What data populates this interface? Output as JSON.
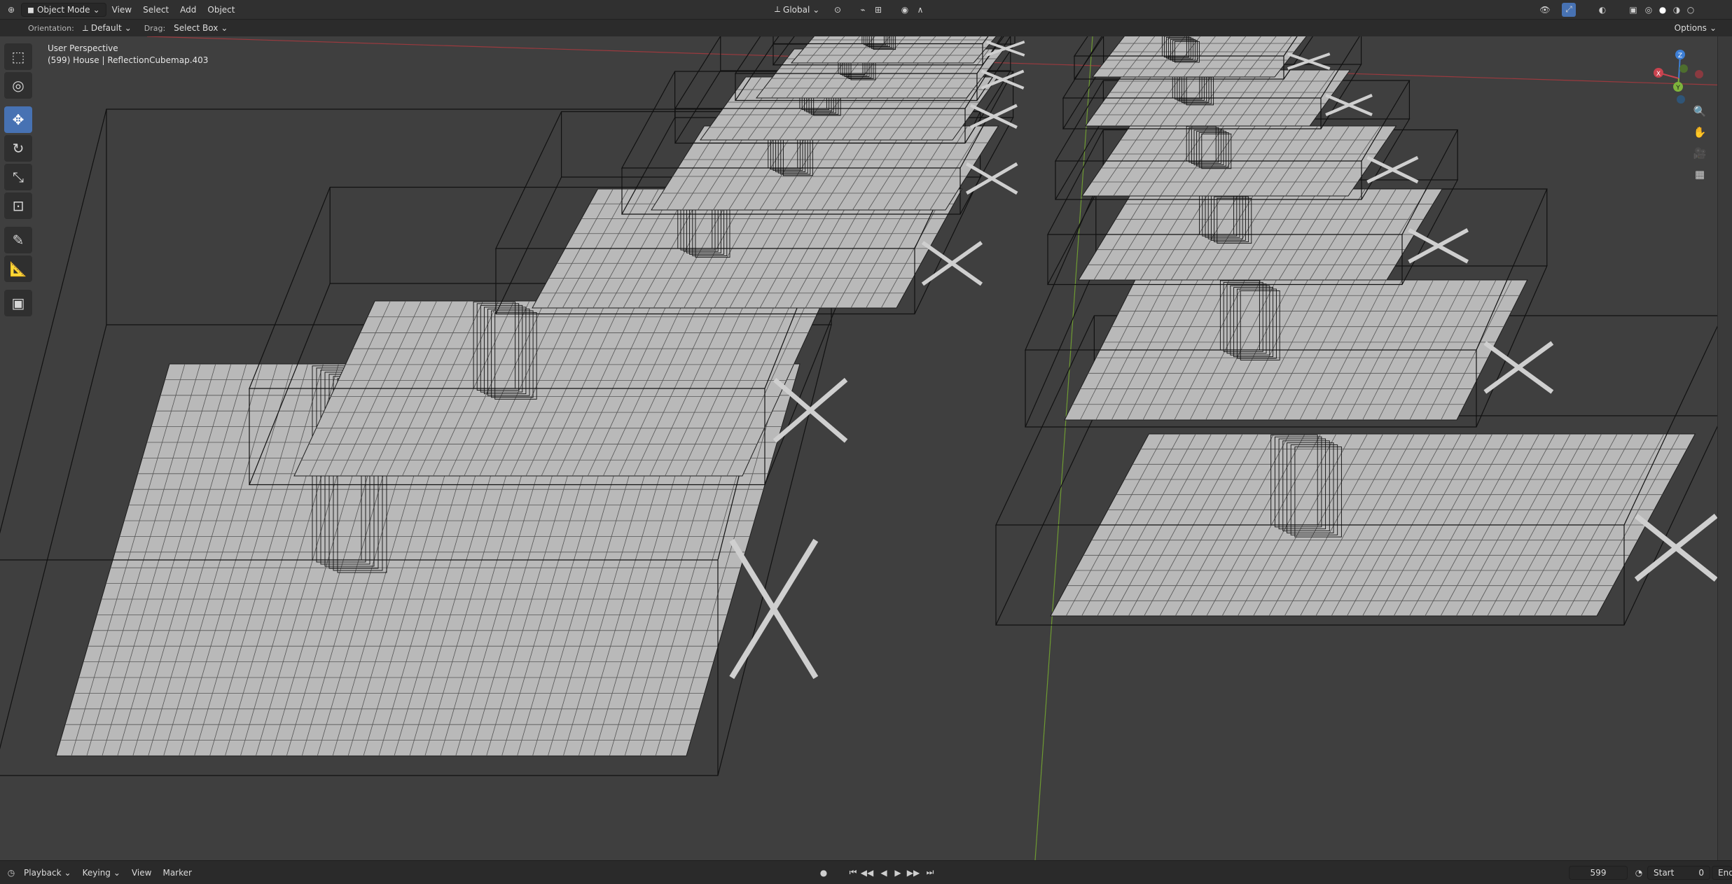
{
  "header": {
    "mode": "Object Mode",
    "menus": [
      "View",
      "Select",
      "Add",
      "Object"
    ],
    "transform_orientation": "Global",
    "options": "Options"
  },
  "tool_settings": {
    "orientation_label": "Orientation:",
    "orientation_value": "Default",
    "drag_label": "Drag:",
    "drag_value": "Select Box"
  },
  "viewport": {
    "perspective": "User Perspective",
    "active_object": "(599) House | ReflectionCubemap.403",
    "gizmo_axes": {
      "z": "Z",
      "y": "Y",
      "x": "X"
    },
    "colors": {
      "x_axis": "#c9434f",
      "y_axis": "#7fb33c",
      "z_axis": "#3d7fd6",
      "active_tool": "#4772b3"
    }
  },
  "toolbar": {
    "tools": [
      "select-box",
      "cursor",
      "move",
      "rotate",
      "scale",
      "transform",
      "annotate",
      "measure",
      "add-cube"
    ],
    "active": "move"
  },
  "timeline": {
    "menus": [
      "Playback",
      "Keying",
      "View",
      "Marker"
    ],
    "current_frame": "599",
    "start_label": "Start",
    "start_value": "0",
    "end_label": "End"
  }
}
